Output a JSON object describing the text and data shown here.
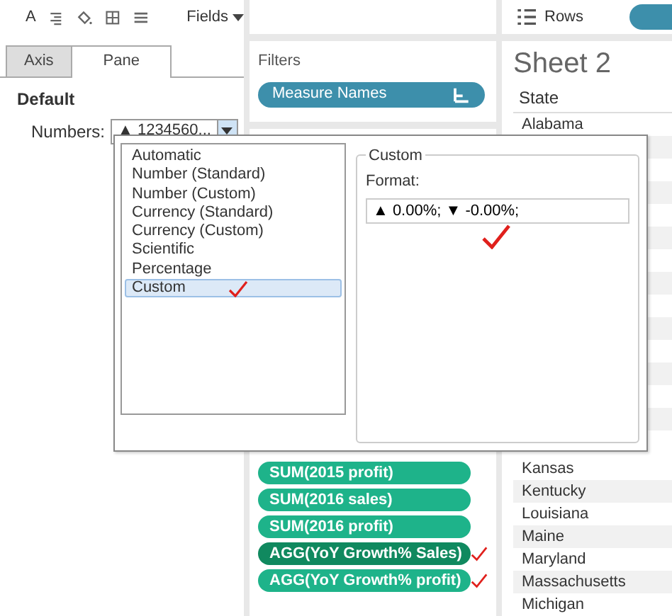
{
  "toolbar": {
    "font_label": "A",
    "fields_button": "Fields"
  },
  "format_tabs": [
    {
      "label": "Axis",
      "selected": false
    },
    {
      "label": "Pane",
      "selected": true
    }
  ],
  "section_title": "Default",
  "numbers": {
    "label": "Numbers:",
    "value": "▲ 1234560..."
  },
  "filters": {
    "title": "Filters",
    "pills": [
      {
        "label": "Measure Names"
      }
    ]
  },
  "measure_pills": [
    {
      "label": "SUM(2015 profit)",
      "selected": false,
      "annotated": false
    },
    {
      "label": "SUM(2016 sales)",
      "selected": false,
      "annotated": false
    },
    {
      "label": "SUM(2016 profit)",
      "selected": false,
      "annotated": false
    },
    {
      "label": "AGG(YoY Growth% Sales)",
      "selected": true,
      "annotated": true
    },
    {
      "label": "AGG(YoY Growth% profit)",
      "selected": false,
      "annotated": true
    }
  ],
  "rows_shelf": {
    "label": "Rows"
  },
  "sheet": {
    "title": "Sheet 2",
    "column": "State",
    "rows_top": [
      "Alabama"
    ],
    "rows_bottom": [
      "Kansas",
      "Kentucky",
      "Louisiana",
      "Maine",
      "Maryland",
      "Massachusetts",
      "Michigan"
    ]
  },
  "format_popup": {
    "options": [
      {
        "label": "Automatic",
        "selected": false,
        "annotated": false
      },
      {
        "label": "Number (Standard)",
        "selected": false,
        "annotated": false
      },
      {
        "label": "Number (Custom)",
        "selected": false,
        "annotated": false
      },
      {
        "label": "Currency (Standard)",
        "selected": false,
        "annotated": false
      },
      {
        "label": "Currency (Custom)",
        "selected": false,
        "annotated": false
      },
      {
        "label": "Scientific",
        "selected": false,
        "annotated": false
      },
      {
        "label": "Percentage",
        "selected": false,
        "annotated": false
      },
      {
        "label": "Custom",
        "selected": true,
        "annotated": true
      }
    ],
    "group_title": "Custom",
    "format_label": "Format:",
    "format_value": "▲ 0.00%; ▼ -0.00%;",
    "format_annotated": true
  }
}
